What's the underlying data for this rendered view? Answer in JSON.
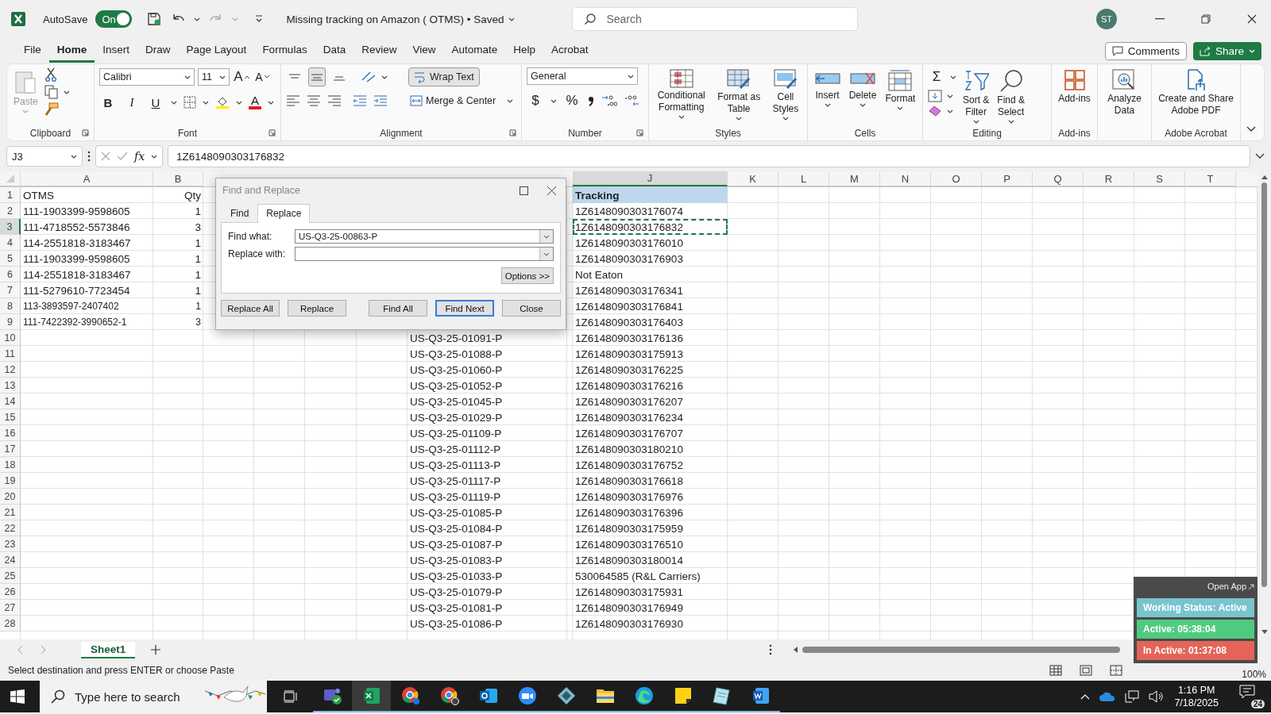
{
  "titlebar": {
    "autosave_label": "AutoSave",
    "autosave": {
      "on": true,
      "label": "On"
    },
    "title": "Missing tracking on Amazon ( OTMS)  •  Saved",
    "search_placeholder": "Search",
    "avatar": "ST"
  },
  "menu": {
    "tabs": [
      {
        "label": "File",
        "selected": false
      },
      {
        "label": "Home",
        "selected": true
      },
      {
        "label": "Insert",
        "selected": false
      },
      {
        "label": "Draw",
        "selected": false
      },
      {
        "label": "Page Layout",
        "selected": false
      },
      {
        "label": "Formulas",
        "selected": false
      },
      {
        "label": "Data",
        "selected": false
      },
      {
        "label": "Review",
        "selected": false
      },
      {
        "label": "View",
        "selected": false
      },
      {
        "label": "Automate",
        "selected": false
      },
      {
        "label": "Help",
        "selected": false
      },
      {
        "label": "Acrobat",
        "selected": false
      }
    ],
    "comments": "Comments",
    "share": "Share"
  },
  "ribbon": {
    "groups": [
      {
        "label": "Clipboard",
        "paste": {
          "label": "Paste",
          "disabled": true
        }
      },
      {
        "label": "Font",
        "font_name": "Calibri",
        "font_size": "11",
        "grow": "A",
        "shrink": "A",
        "bold": "B",
        "italic": "I",
        "underline": "U",
        "font_color": "A"
      },
      {
        "label": "Alignment",
        "vertical_align": [
          {
            "selected": false
          },
          {
            "selected": true
          },
          {
            "selected": false
          }
        ],
        "wrap_text": {
          "label": "Wrap Text",
          "on": true
        },
        "merge": "Merge & Center"
      },
      {
        "label": "Number",
        "format": "General",
        "currency": "$",
        "percent": "%"
      },
      {
        "label": "Styles",
        "buttons": [
          "Conditional\nFormatting",
          "Format as\nTable",
          "Cell\nStyles"
        ]
      },
      {
        "label": "Cells",
        "buttons": [
          "Insert",
          "Delete",
          "Format"
        ]
      },
      {
        "label": "Editing",
        "autosum": "Σ",
        "buttons": [
          "Sort &\nFilter",
          "Find &\nSelect"
        ]
      },
      {
        "label": "Add-ins",
        "buttons": [
          "Add-ins"
        ]
      },
      {
        "buttons": [
          "Analyze\nData"
        ]
      },
      {
        "label": "Adobe Acrobat",
        "buttons": [
          "Create and Share\nAdobe PDF"
        ]
      }
    ]
  },
  "formula_bar": {
    "name_box": "J3",
    "fx": "fx",
    "formula": "1Z6148090303176832"
  },
  "sheet": {
    "column_headers": [
      "A",
      "B",
      "J",
      "K",
      "L",
      "M",
      "N",
      "O",
      "P",
      "Q",
      "R",
      "S",
      "T"
    ],
    "rows": [
      {
        "number": "1",
        "kind": "header",
        "selected": false,
        "A": "OTMS",
        "B": "Qty",
        "J": "Tracking"
      },
      {
        "number": "2",
        "kind": "data",
        "selected": false,
        "A": "111-1903399-9598605",
        "B": "1",
        "J": "1Z6148090303176074"
      },
      {
        "number": "3",
        "kind": "data",
        "selected": true,
        "A": "111-4718552-5573846",
        "B": "3",
        "J": "1Z6148090303176832"
      },
      {
        "number": "4",
        "kind": "data",
        "selected": false,
        "A": "114-2551818-3183467",
        "B": "1",
        "J": "1Z6148090303176010"
      },
      {
        "number": "5",
        "kind": "data",
        "selected": false,
        "A": "111-1903399-9598605",
        "B": "1",
        "J": "1Z6148090303176903"
      },
      {
        "number": "6",
        "kind": "data",
        "selected": false,
        "A": "114-2551818-3183467",
        "B": "1",
        "J": "Not Eaton"
      },
      {
        "number": "7",
        "kind": "data",
        "selected": false,
        "A": "111-5279610-7723454",
        "B": "1",
        "J": "1Z6148090303176341"
      },
      {
        "number": "8",
        "kind": "pasted",
        "selected": false,
        "A": "113-3893597-2407402",
        "B": "1",
        "J": "1Z6148090303176841"
      },
      {
        "number": "9",
        "kind": "pasted",
        "selected": false,
        "A": "111-7422392-3990652-1",
        "B": "3",
        "J": "1Z6148090303176403"
      },
      {
        "number": "10",
        "kind": "data",
        "selected": false,
        "G": "US-Q3-25-01091-P",
        "J": "1Z6148090303176136"
      },
      {
        "number": "11",
        "kind": "data",
        "selected": false,
        "G": "US-Q3-25-01088-P",
        "J": "1Z6148090303175913"
      },
      {
        "number": "12",
        "kind": "data",
        "selected": false,
        "G": "US-Q3-25-01060-P",
        "J": "1Z6148090303176225"
      },
      {
        "number": "13",
        "kind": "data",
        "selected": false,
        "G": "US-Q3-25-01052-P",
        "J": "1Z6148090303176216"
      },
      {
        "number": "14",
        "kind": "data",
        "selected": false,
        "G": "US-Q3-25-01045-P",
        "J": "1Z6148090303176207"
      },
      {
        "number": "15",
        "kind": "data",
        "selected": false,
        "G": "US-Q3-25-01029-P",
        "J": "1Z6148090303176234"
      },
      {
        "number": "16",
        "kind": "data",
        "selected": false,
        "G": "US-Q3-25-01109-P",
        "J": "1Z6148090303176707"
      },
      {
        "number": "17",
        "kind": "data",
        "selected": false,
        "G": "US-Q3-25-01112-P",
        "J": "1Z6148090303180210"
      },
      {
        "number": "18",
        "kind": "data",
        "selected": false,
        "G": "US-Q3-25-01113-P",
        "J": "1Z6148090303176752"
      },
      {
        "number": "19",
        "kind": "data",
        "selected": false,
        "G": "US-Q3-25-01117-P",
        "J": "1Z6148090303176618"
      },
      {
        "number": "20",
        "kind": "data",
        "selected": false,
        "G": "US-Q3-25-01119-P",
        "J": "1Z6148090303176976"
      },
      {
        "number": "21",
        "kind": "data",
        "selected": false,
        "G": "US-Q3-25-01085-P",
        "J": "1Z6148090303176396"
      },
      {
        "number": "22",
        "kind": "data",
        "selected": false,
        "G": "US-Q3-25-01084-P",
        "J": "1Z6148090303175959"
      },
      {
        "number": "23",
        "kind": "data",
        "selected": false,
        "G": "US-Q3-25-01087-P",
        "J": "1Z6148090303176510"
      },
      {
        "number": "24",
        "kind": "data",
        "selected": false,
        "G": "US-Q3-25-01083-P",
        "J": "1Z6148090303180014"
      },
      {
        "number": "25",
        "kind": "data",
        "selected": false,
        "G": "US-Q3-25-01033-P",
        "J": "530064585 (R&L Carriers)"
      },
      {
        "number": "26",
        "kind": "data",
        "selected": false,
        "G": "US-Q3-25-01079-P",
        "J": "1Z6148090303175931"
      },
      {
        "number": "27",
        "kind": "data",
        "selected": false,
        "G": "US-Q3-25-01081-P",
        "J": "1Z6148090303176949"
      },
      {
        "number": "28",
        "kind": "data",
        "selected": false,
        "G": "US-Q3-25-01086-P",
        "J": "1Z6148090303176930"
      }
    ]
  },
  "dialog": {
    "title": "Find and Replace",
    "tabs": [
      {
        "label": "Find",
        "selected": false
      },
      {
        "label": "Replace",
        "selected": true
      }
    ],
    "find_label": "Find what:",
    "find_value": "US-Q3-25-00863-P",
    "replace_label": "Replace with:",
    "options": "Options >>",
    "buttons": [
      {
        "label": "Replace All",
        "default": false
      },
      {
        "label": "Replace",
        "default": false
      },
      {
        "label": "Find All",
        "default": false
      },
      {
        "label": "Find Next",
        "default": true
      },
      {
        "label": "Close",
        "default": false
      }
    ]
  },
  "sheet_tabs": [
    {
      "label": "Sheet1",
      "selected": true
    }
  ],
  "status_bar": {
    "message": "Select destination and press ENTER or choose Paste",
    "zoom": "100%"
  },
  "tracker": {
    "open_app": "Open App",
    "rows": [
      {
        "text": "Working Status: Active",
        "color": "#79c4cf"
      },
      {
        "text": "Active: 05:38:04",
        "color": "#4fcb7f"
      },
      {
        "text": "In Active: 01:37:08",
        "color": "#e5645a"
      }
    ]
  },
  "taskbar": {
    "search_placeholder": "Type here to search",
    "apps": [
      {
        "selected": false
      },
      {
        "selected": true
      },
      {
        "selected": false
      },
      {
        "selected": false
      },
      {
        "selected": false
      },
      {
        "selected": false
      },
      {
        "selected": false
      },
      {
        "selected": false
      },
      {
        "selected": false
      },
      {
        "selected": false
      },
      {
        "selected": false
      },
      {
        "selected": false
      }
    ],
    "time": "1:16 PM",
    "date": "7/18/2025",
    "notifications": "24"
  }
}
